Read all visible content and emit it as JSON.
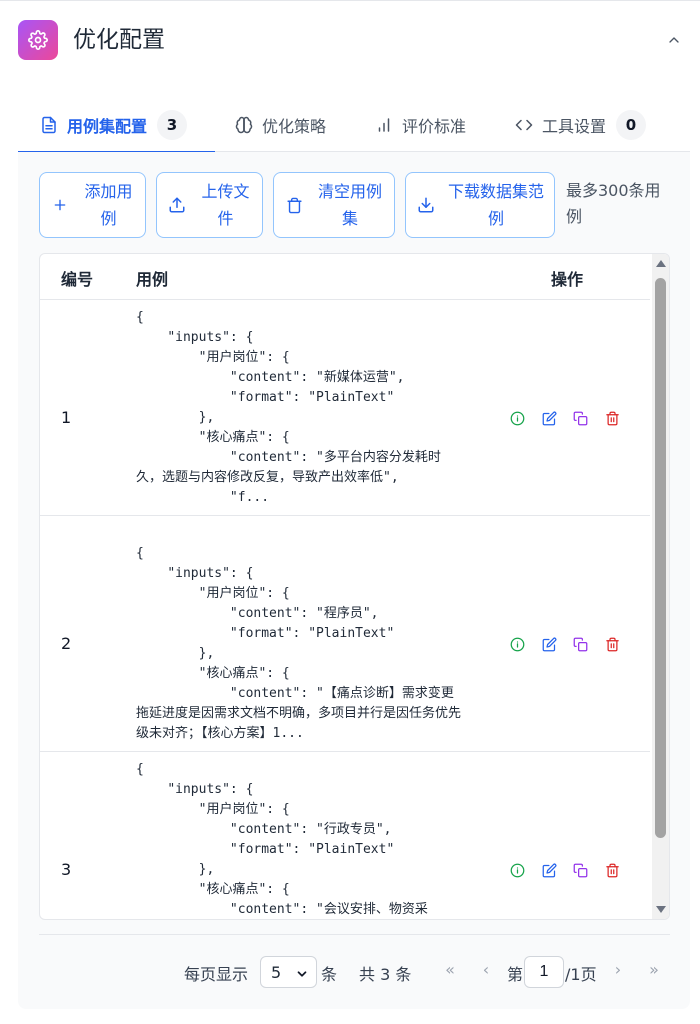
{
  "header": {
    "title": "优化配置",
    "icon": "gear-icon",
    "collapse_icon": "chevron-up-icon"
  },
  "tabs": [
    {
      "label": "用例集配置",
      "icon": "document-icon",
      "count": "3",
      "active": true
    },
    {
      "label": "优化策略",
      "icon": "brain-icon",
      "active": false
    },
    {
      "label": "评价标准",
      "icon": "bar-chart-icon",
      "active": false
    },
    {
      "label": "工具设置",
      "icon": "code-icon",
      "count": "0",
      "active": false
    }
  ],
  "toolbar": {
    "add_line1": "添加用",
    "add_line2": "例",
    "upload_line1": "上传文",
    "upload_line2": "件",
    "clear_line1": "清空用例",
    "clear_line2": "集",
    "download_line1": "下载数据集范",
    "download_line2": "例",
    "hint_line1": "最多300条用",
    "hint_line2": "例"
  },
  "table": {
    "headers": {
      "num": "编号",
      "case": "用例",
      "actions": "操作"
    },
    "rows": [
      {
        "num": "1",
        "content": "{\n    \"inputs\": {\n        \"用户岗位\": {\n            \"content\": \"新媒体运营\",\n            \"format\": \"PlainText\"\n        },\n        \"核心痛点\": {\n            \"content\": \"多平台内容分发耗时久，选题与内容修改反复，导致产出效率低\",\n            \"f..."
      },
      {
        "num": "2",
        "content": "{\n    \"inputs\": {\n        \"用户岗位\": {\n            \"content\": \"程序员\",\n            \"format\": \"PlainText\"\n        },\n        \"核心痛点\": {\n            \"content\": \"【痛点诊断】需求变更拖延进度是因需求文档不明确，多项目并行是因任务优先级未对齐；【核心方案】1..."
      },
      {
        "num": "3",
        "content": "{\n    \"inputs\": {\n        \"用户岗位\": {\n            \"content\": \"行政专员\",\n            \"format\": \"PlainText\"\n        },\n        \"核心痛点\": {\n            \"content\": \"会议安排、物资采"
      }
    ],
    "action_icons": [
      "info-icon",
      "edit-icon",
      "copy-icon",
      "delete-icon"
    ]
  },
  "pagination": {
    "per_page_label": "每页显示",
    "per_page_value": "5",
    "per_page_unit": "条",
    "total": "共 3 条",
    "page_prefix": "第",
    "page_value": "1",
    "page_suffix": "/1页"
  },
  "colors": {
    "accent": "#2563eb",
    "info": "#16a34a",
    "edit": "#2563eb",
    "copy": "#9333ea",
    "delete": "#dc2626"
  }
}
